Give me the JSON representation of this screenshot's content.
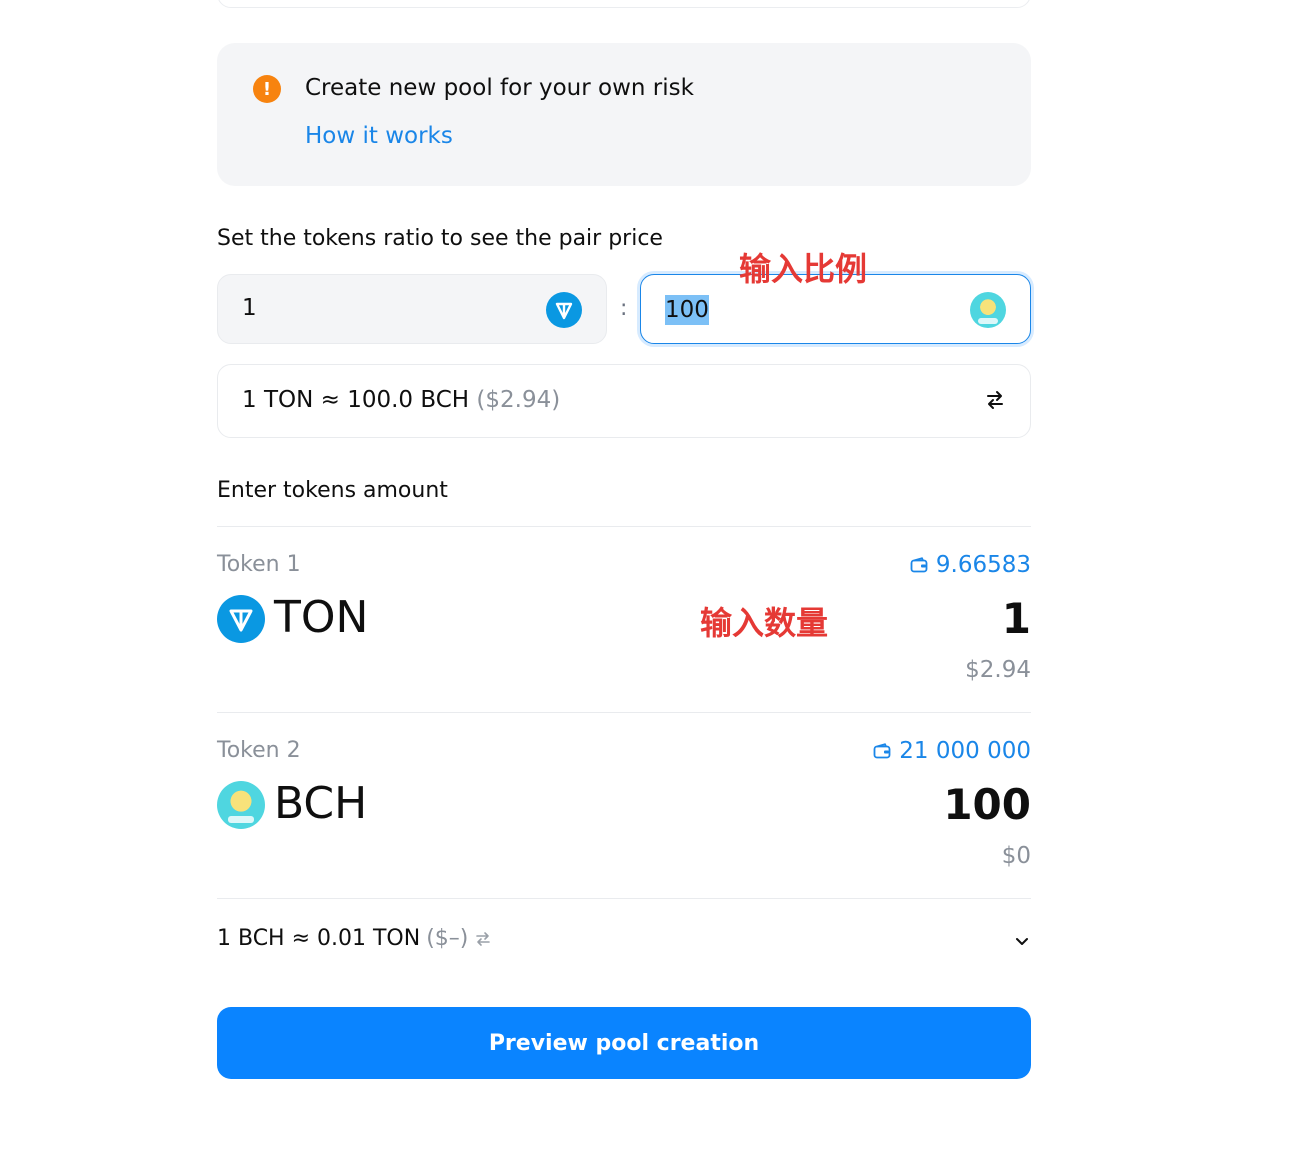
{
  "notice": {
    "text": "Create new pool for your own risk",
    "link": "How it works",
    "icon": "warning-icon"
  },
  "ratio": {
    "title": "Set the tokens ratio to see the pair price",
    "left_value": "1",
    "right_value": "100",
    "separator": ":",
    "rate_main": "1 TON ≈ 100.0 BCH",
    "rate_usd": "($2.94)"
  },
  "amounts": {
    "title": "Enter tokens amount",
    "token1": {
      "label": "Token 1",
      "symbol": "TON",
      "balance": "9.66583",
      "amount": "1",
      "usd": "$2.94"
    },
    "token2": {
      "label": "Token 2",
      "symbol": "BCH",
      "balance": "21 000 000",
      "amount": "100",
      "usd": "$0"
    }
  },
  "rate2": {
    "main": "1 BCH ≈ 0.01 TON",
    "usd": "($–)"
  },
  "button": {
    "label": "Preview pool creation"
  },
  "annotations": {
    "ratio": "输入比例",
    "amount": "输入数量"
  },
  "colors": {
    "accent": "#0a84ff",
    "link": "#1a86e8",
    "warning": "#f7830f",
    "annotation": "#e53935"
  }
}
